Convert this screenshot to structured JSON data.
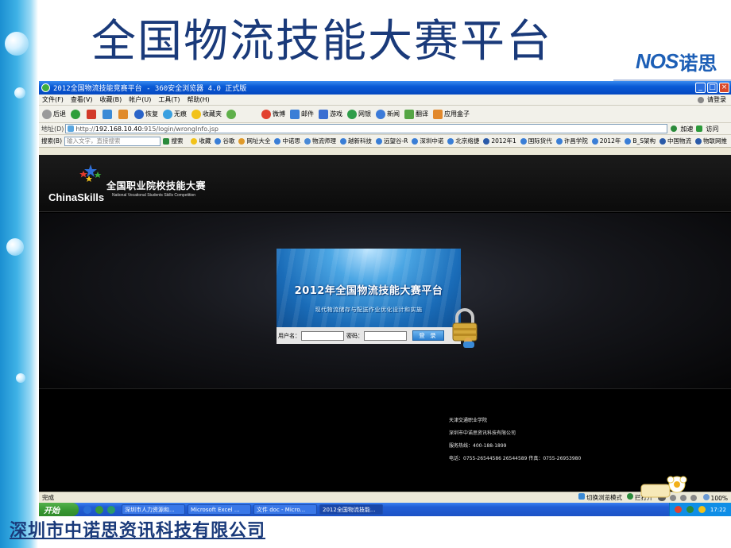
{
  "slide": {
    "title": "全国物流技能大赛平台",
    "brand_latin": "NOS",
    "brand_cn": "诺思",
    "company": "深圳市中诺思资讯科技有限公司"
  },
  "browser": {
    "window_title": "2012全国物流技能竞赛平台 - 360安全浏览器 4.0 正式版",
    "menu": [
      "文件(F)",
      "查看(V)",
      "收藏(B)",
      "帐户(U)",
      "工具(T)",
      "帮助(H)"
    ],
    "menu_right": "请登录",
    "toolbar": {
      "back": "后退",
      "refresh": "恢复",
      "no_image": "无痕",
      "favorites": "收藏夹",
      "weibo": "微博",
      "mail": "邮件",
      "game": "游戏",
      "netbank": "网银",
      "news": "新闻",
      "translate": "翻译",
      "appbox": "应用盒子"
    },
    "address": {
      "label": "地址(D)",
      "url_prefix": "http://",
      "url_host": "192.168.10.40",
      "url_path": ":915/login/wrongInfo.jsp",
      "add_button": "加速",
      "go_button": "访问"
    },
    "favbar": {
      "search_label": "搜索(B)",
      "search_placeholder": "输入文字，直接搜索",
      "search_button": "搜索",
      "items": [
        "收藏",
        "谷歌",
        "网址大全",
        "中诺思",
        "物流师理",
        "越新科技",
        "远望谷-R",
        "深圳中诺",
        "北京络捷",
        "2012年1",
        "国际货代",
        "许昌学院",
        "2012年",
        "B_S架构",
        "中国物流",
        "物联网推"
      ]
    },
    "status_left": "完成",
    "status_right": {
      "mode": "切换浏览模式",
      "popup": "拦打开",
      "zoom": "100%"
    }
  },
  "site": {
    "brand_en": "ChinaSkills",
    "brand_cn": "全国职业院校技能大赛",
    "brand_sub": "National Vocational Students Skills Competition",
    "login": {
      "banner_title": "2012年全国物流技能大赛平台",
      "banner_sub": "现代物流储存与配送作业优化设计和实施",
      "username_label": "用户名：",
      "password_label": "密码：",
      "submit_label": "登 录"
    },
    "footer": [
      "天津交通职业学院",
      "深圳市中诺思资讯科技有限公司",
      "服务热线：400-188-1899",
      "电话：0755-26544586 26544589 传真：0755-26953980"
    ]
  },
  "taskbar": {
    "start": "开始",
    "tasks": [
      "深圳市人力资源和...",
      "Microsoft Excel ...",
      "文件 doc - Micro...",
      "2012全国物流技能..."
    ],
    "clock": "17:22"
  }
}
